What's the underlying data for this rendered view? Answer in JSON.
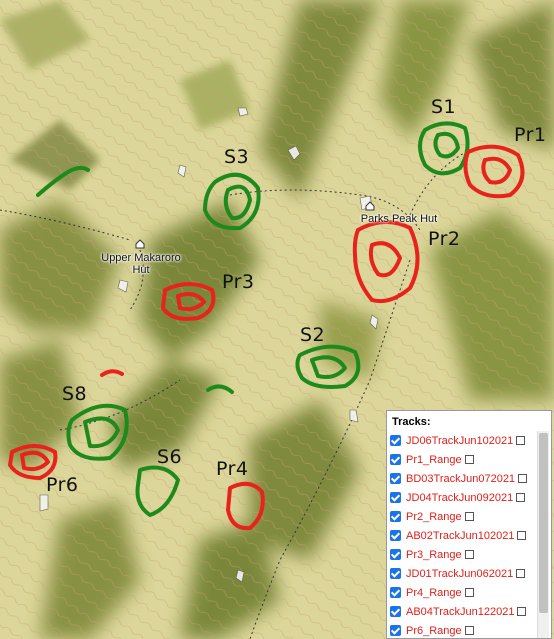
{
  "map": {
    "huts": [
      {
        "name": "Upper Makaroro\nHut",
        "line1": "Upper Makaroro",
        "line2": "Hut"
      },
      {
        "name": "Parks Peak Hut"
      }
    ],
    "areas": [
      {
        "label": "S1",
        "color": "#1e8a1e"
      },
      {
        "label": "Pr1",
        "color": "#e8221c"
      },
      {
        "label": "S3",
        "color": "#1e8a1e"
      },
      {
        "label": "Pr2",
        "color": "#e8221c"
      },
      {
        "label": "Pr3",
        "color": "#e8221c"
      },
      {
        "label": "S2",
        "color": "#1e8a1e"
      },
      {
        "label": "S8",
        "color": "#1e8a1e"
      },
      {
        "label": "S6",
        "color": "#1e8a1e"
      },
      {
        "label": "Pr4",
        "color": "#e8221c"
      },
      {
        "label": "Pr6",
        "color": "#e8221c"
      }
    ],
    "colors": {
      "green_track": "#1e8a1e",
      "red_track": "#e8221c"
    }
  },
  "tracks_panel": {
    "title": "Tracks:",
    "items": [
      {
        "label": "JD06TrackJun102021",
        "checked": true
      },
      {
        "label": "Pr1_Range",
        "checked": true
      },
      {
        "label": "BD03TrackJun072021",
        "checked": true
      },
      {
        "label": "JD04TrackJun092021",
        "checked": true
      },
      {
        "label": "Pr2_Range",
        "checked": true
      },
      {
        "label": "AB02TrackJun102021",
        "checked": true
      },
      {
        "label": "Pr3_Range",
        "checked": true
      },
      {
        "label": "JD01TrackJun062021",
        "checked": true
      },
      {
        "label": "Pr4_Range",
        "checked": true
      },
      {
        "label": "AB04TrackJun122021",
        "checked": true
      },
      {
        "label": "Pr6_Range",
        "checked": true
      }
    ],
    "icons": {
      "checkbox": "checkbox-checked-icon",
      "external": "external-link-icon"
    }
  }
}
